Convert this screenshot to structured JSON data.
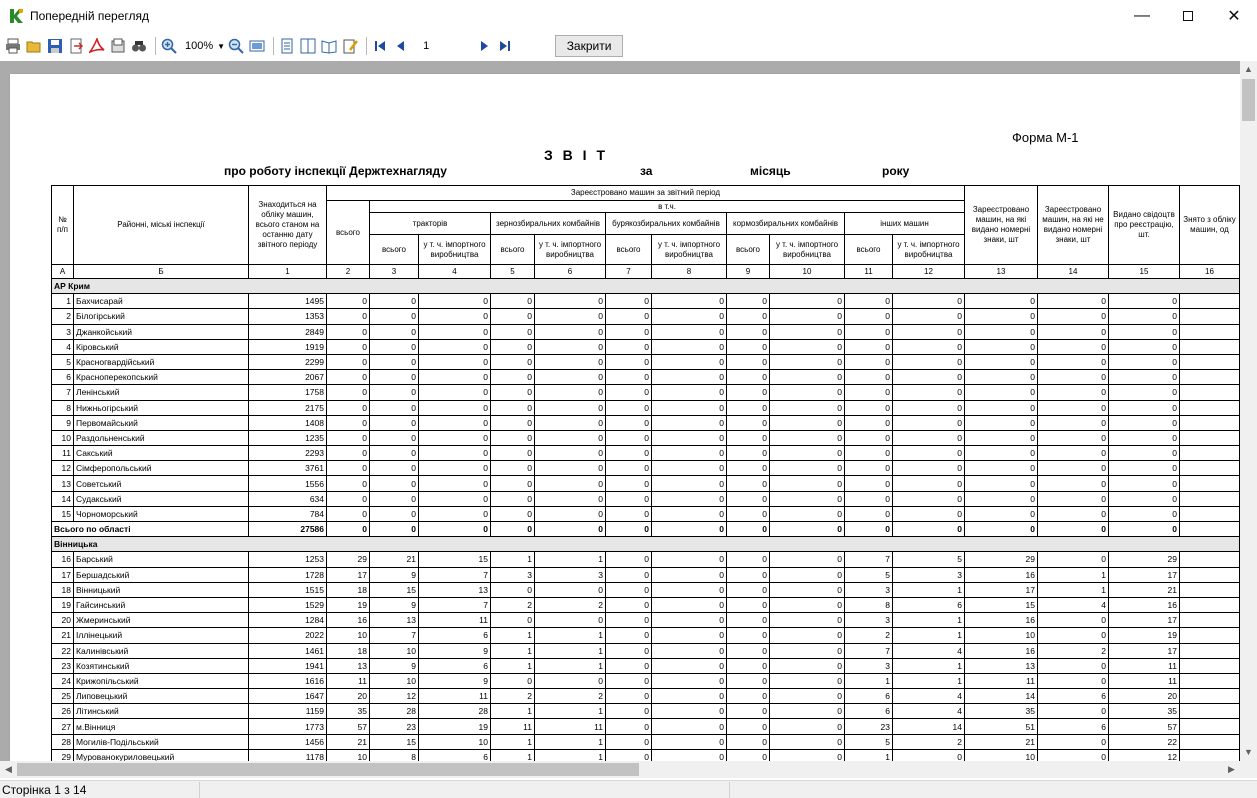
{
  "window": {
    "title": "Попередній перегляд"
  },
  "toolbar": {
    "zoom": "100%",
    "page": "1",
    "close_label": "Закрити",
    "icons": [
      "print-icon",
      "open-icon",
      "save-icon",
      "export-icon",
      "pdf-icon",
      "email-icon",
      "find-icon",
      "zoom-in-icon",
      "zoom-out-icon",
      "page-width-icon",
      "one-page-icon",
      "two-pages-icon",
      "book-icon",
      "edit-icon",
      "first-page-icon",
      "prev-page-icon",
      "next-page-icon",
      "last-page-icon"
    ]
  },
  "status": {
    "page_info": "Сторінка 1 з 14"
  },
  "report": {
    "form_code": "Форма М-1",
    "title": "З В І Т",
    "subtitle_left": "про роботу інспекції Держтехнагляду",
    "subtitle_za": "за",
    "subtitle_month": "місяць",
    "subtitle_year": "року",
    "headers": {
      "num": "№ п/п",
      "inspections": "Районні, міські інспекції",
      "on_record": "Знаходиться на обліку машин, всього станом на останню дату звітного періоду",
      "registered": "Зареєстровано машин за звітний період",
      "total": "всього",
      "incl": "в т.ч.",
      "tractors": "тракторів",
      "grain": "зернозбиральних комбайнів",
      "beet": "бурякозбиральних комбайнів",
      "forage": "кормозбиральних комбайнів",
      "other": "інших машин",
      "sub_total": "всього",
      "sub_import": "у т. ч. імпортного виробництва",
      "col13": "Зареєстровано машин, на які видано номерні знаки, шт",
      "col14": "Зареєстровано машин, на які не видано номерні знаки, шт",
      "col15": "Видано свідоцтв про реєстрацію, шт.",
      "col16": "Знято з обліку машин, од"
    },
    "col_codes": [
      "А",
      "Б",
      "1",
      "2",
      "3",
      "4",
      "5",
      "6",
      "7",
      "8",
      "9",
      "10",
      "11",
      "12",
      "13",
      "14",
      "15",
      "16"
    ],
    "regions": [
      {
        "name": "АР Крим",
        "rows": [
          {
            "n": "1",
            "name": "Бахчисарай",
            "v": [
              "1495",
              "0",
              "0",
              "0",
              "0",
              "0",
              "0",
              "0",
              "0",
              "0",
              "0",
              "0",
              "0",
              "0",
              "0"
            ]
          },
          {
            "n": "2",
            "name": "Білогірський",
            "v": [
              "1353",
              "0",
              "0",
              "0",
              "0",
              "0",
              "0",
              "0",
              "0",
              "0",
              "0",
              "0",
              "0",
              "0",
              "0"
            ]
          },
          {
            "n": "3",
            "name": "Джанкойський",
            "v": [
              "2849",
              "0",
              "0",
              "0",
              "0",
              "0",
              "0",
              "0",
              "0",
              "0",
              "0",
              "0",
              "0",
              "0",
              "0"
            ]
          },
          {
            "n": "4",
            "name": "Кіровський",
            "v": [
              "1919",
              "0",
              "0",
              "0",
              "0",
              "0",
              "0",
              "0",
              "0",
              "0",
              "0",
              "0",
              "0",
              "0",
              "0"
            ]
          },
          {
            "n": "5",
            "name": "Красногвардійський",
            "v": [
              "2299",
              "0",
              "0",
              "0",
              "0",
              "0",
              "0",
              "0",
              "0",
              "0",
              "0",
              "0",
              "0",
              "0",
              "0"
            ]
          },
          {
            "n": "6",
            "name": "Красноперекопський",
            "v": [
              "2067",
              "0",
              "0",
              "0",
              "0",
              "0",
              "0",
              "0",
              "0",
              "0",
              "0",
              "0",
              "0",
              "0",
              "0"
            ]
          },
          {
            "n": "7",
            "name": "Ленінський",
            "v": [
              "1758",
              "0",
              "0",
              "0",
              "0",
              "0",
              "0",
              "0",
              "0",
              "0",
              "0",
              "0",
              "0",
              "0",
              "0"
            ]
          },
          {
            "n": "8",
            "name": "Нижньогірський",
            "v": [
              "2175",
              "0",
              "0",
              "0",
              "0",
              "0",
              "0",
              "0",
              "0",
              "0",
              "0",
              "0",
              "0",
              "0",
              "0"
            ]
          },
          {
            "n": "9",
            "name": "Первомайський",
            "v": [
              "1408",
              "0",
              "0",
              "0",
              "0",
              "0",
              "0",
              "0",
              "0",
              "0",
              "0",
              "0",
              "0",
              "0",
              "0"
            ]
          },
          {
            "n": "10",
            "name": "Раздольненський",
            "v": [
              "1235",
              "0",
              "0",
              "0",
              "0",
              "0",
              "0",
              "0",
              "0",
              "0",
              "0",
              "0",
              "0",
              "0",
              "0"
            ]
          },
          {
            "n": "11",
            "name": "Сакський",
            "v": [
              "2293",
              "0",
              "0",
              "0",
              "0",
              "0",
              "0",
              "0",
              "0",
              "0",
              "0",
              "0",
              "0",
              "0",
              "0"
            ]
          },
          {
            "n": "12",
            "name": "Сімферопольський",
            "v": [
              "3761",
              "0",
              "0",
              "0",
              "0",
              "0",
              "0",
              "0",
              "0",
              "0",
              "0",
              "0",
              "0",
              "0",
              "0"
            ]
          },
          {
            "n": "13",
            "name": "Советський",
            "v": [
              "1556",
              "0",
              "0",
              "0",
              "0",
              "0",
              "0",
              "0",
              "0",
              "0",
              "0",
              "0",
              "0",
              "0",
              "0"
            ]
          },
          {
            "n": "14",
            "name": "Судакський",
            "v": [
              "634",
              "0",
              "0",
              "0",
              "0",
              "0",
              "0",
              "0",
              "0",
              "0",
              "0",
              "0",
              "0",
              "0",
              "0"
            ]
          },
          {
            "n": "15",
            "name": "Чорноморський",
            "v": [
              "784",
              "0",
              "0",
              "0",
              "0",
              "0",
              "0",
              "0",
              "0",
              "0",
              "0",
              "0",
              "0",
              "0",
              "0"
            ]
          }
        ],
        "total": {
          "name": "Всього по області",
          "v": [
            "27586",
            "0",
            "0",
            "0",
            "0",
            "0",
            "0",
            "0",
            "0",
            "0",
            "0",
            "0",
            "0",
            "0",
            "0"
          ]
        }
      },
      {
        "name": "Вінницька",
        "rows": [
          {
            "n": "16",
            "name": "Барський",
            "v": [
              "1253",
              "29",
              "21",
              "15",
              "1",
              "1",
              "0",
              "0",
              "0",
              "0",
              "7",
              "5",
              "29",
              "0",
              "29"
            ]
          },
          {
            "n": "17",
            "name": "Бершадський",
            "v": [
              "1728",
              "17",
              "9",
              "7",
              "3",
              "3",
              "0",
              "0",
              "0",
              "0",
              "5",
              "3",
              "16",
              "1",
              "17"
            ]
          },
          {
            "n": "18",
            "name": "Вінницький",
            "v": [
              "1515",
              "18",
              "15",
              "13",
              "0",
              "0",
              "0",
              "0",
              "0",
              "0",
              "3",
              "1",
              "17",
              "1",
              "21"
            ]
          },
          {
            "n": "19",
            "name": "Гайсинський",
            "v": [
              "1529",
              "19",
              "9",
              "7",
              "2",
              "2",
              "0",
              "0",
              "0",
              "0",
              "8",
              "6",
              "15",
              "4",
              "16"
            ]
          },
          {
            "n": "20",
            "name": "Жмеринський",
            "v": [
              "1284",
              "16",
              "13",
              "11",
              "0",
              "0",
              "0",
              "0",
              "0",
              "0",
              "3",
              "1",
              "16",
              "0",
              "17"
            ]
          },
          {
            "n": "21",
            "name": "Іллінецький",
            "v": [
              "2022",
              "10",
              "7",
              "6",
              "1",
              "1",
              "0",
              "0",
              "0",
              "0",
              "2",
              "1",
              "10",
              "0",
              "19"
            ]
          },
          {
            "n": "22",
            "name": "Калинівський",
            "v": [
              "1461",
              "18",
              "10",
              "9",
              "1",
              "1",
              "0",
              "0",
              "0",
              "0",
              "7",
              "4",
              "16",
              "2",
              "17"
            ]
          },
          {
            "n": "23",
            "name": "Козятинський",
            "v": [
              "1941",
              "13",
              "9",
              "6",
              "1",
              "1",
              "0",
              "0",
              "0",
              "0",
              "3",
              "1",
              "13",
              "0",
              "11"
            ]
          },
          {
            "n": "24",
            "name": "Крижопільський",
            "v": [
              "1616",
              "11",
              "10",
              "9",
              "0",
              "0",
              "0",
              "0",
              "0",
              "0",
              "1",
              "1",
              "11",
              "0",
              "11"
            ]
          },
          {
            "n": "25",
            "name": "Липовецький",
            "v": [
              "1647",
              "20",
              "12",
              "11",
              "2",
              "2",
              "0",
              "0",
              "0",
              "0",
              "6",
              "4",
              "14",
              "6",
              "20"
            ]
          },
          {
            "n": "26",
            "name": "Літинський",
            "v": [
              "1159",
              "35",
              "28",
              "28",
              "1",
              "1",
              "0",
              "0",
              "0",
              "0",
              "6",
              "4",
              "35",
              "0",
              "35"
            ]
          },
          {
            "n": "27",
            "name": "м.Вінниця",
            "v": [
              "1773",
              "57",
              "23",
              "19",
              "11",
              "11",
              "0",
              "0",
              "0",
              "0",
              "23",
              "14",
              "51",
              "6",
              "57"
            ]
          },
          {
            "n": "28",
            "name": "Могилів-Подільський",
            "v": [
              "1456",
              "21",
              "15",
              "10",
              "1",
              "1",
              "0",
              "0",
              "0",
              "0",
              "5",
              "2",
              "21",
              "0",
              "22"
            ]
          },
          {
            "n": "29",
            "name": "Мурованокуриловецький",
            "v": [
              "1178",
              "10",
              "8",
              "6",
              "1",
              "1",
              "0",
              "0",
              "0",
              "0",
              "1",
              "0",
              "10",
              "0",
              "12"
            ]
          }
        ]
      }
    ]
  }
}
